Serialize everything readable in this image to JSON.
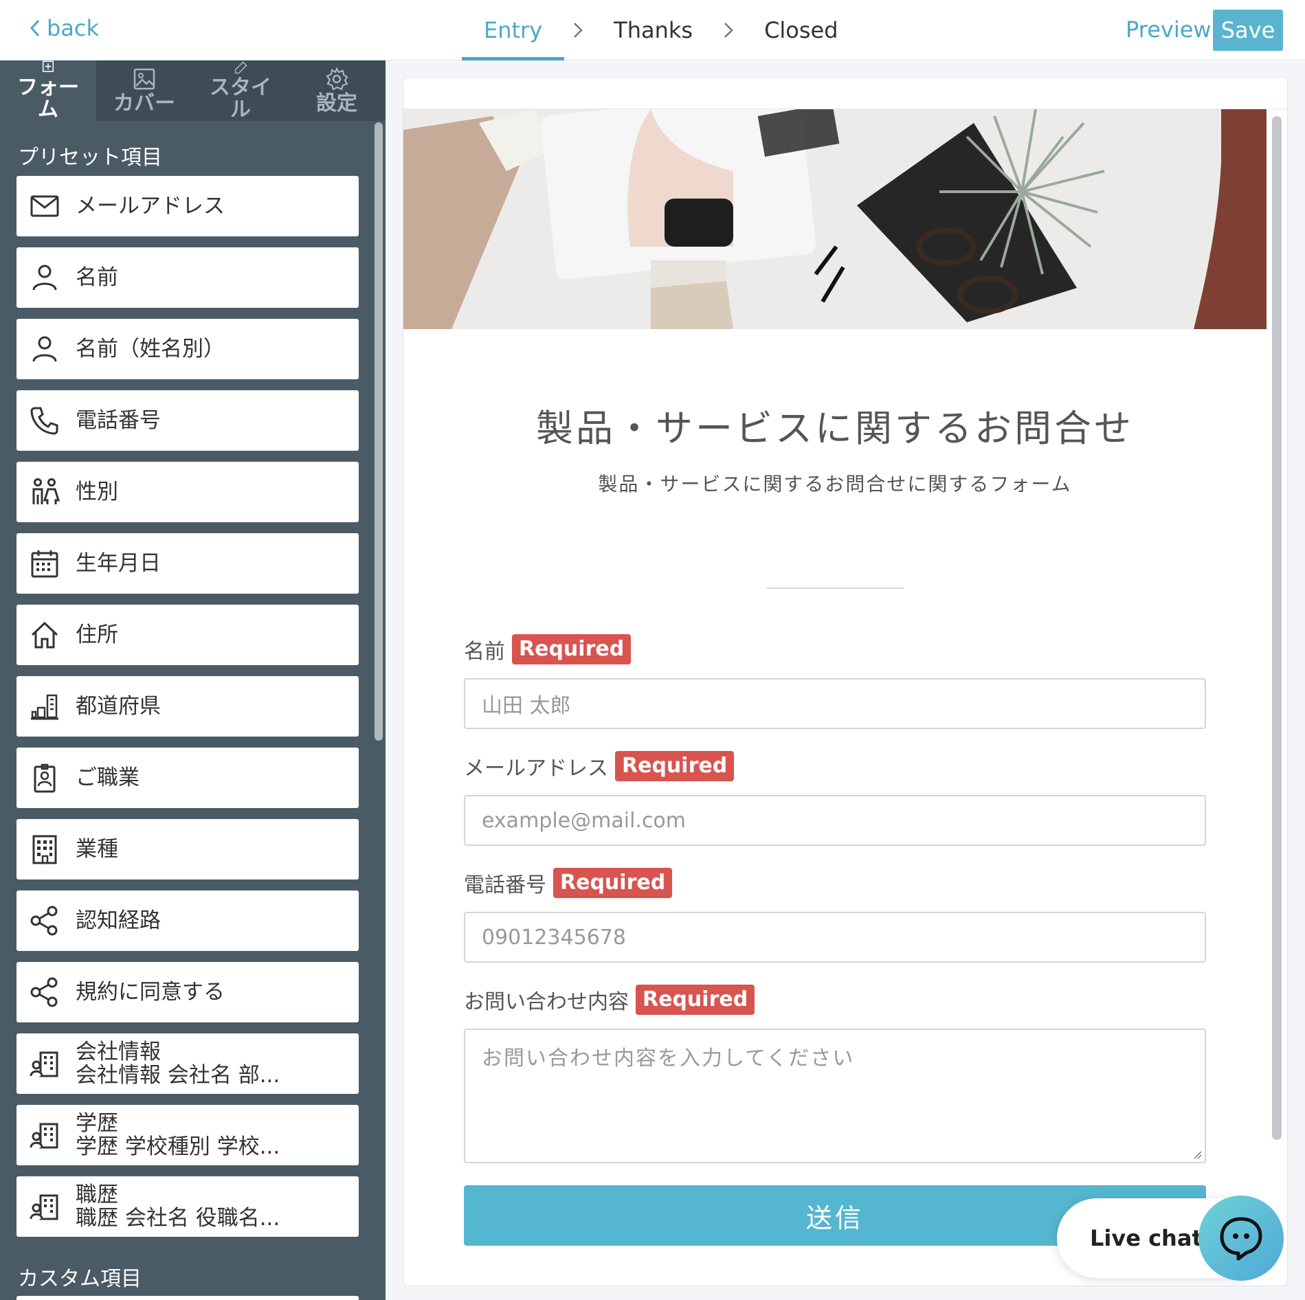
{
  "topbar": {
    "back_label": "back",
    "steps": [
      {
        "label": "Entry",
        "active": true
      },
      {
        "label": "Thanks",
        "active": false
      },
      {
        "label": "Closed",
        "active": false
      }
    ],
    "preview_label": "Preview",
    "save_label": "Save"
  },
  "sidebar": {
    "tabs": [
      {
        "label": "フォーム",
        "icon": "plus-square-icon",
        "active": true
      },
      {
        "label": "カバー",
        "icon": "image-icon",
        "active": false
      },
      {
        "label": "スタイル",
        "icon": "pen-icon",
        "active": false
      },
      {
        "label": "設定",
        "icon": "gear-icon",
        "active": false
      }
    ],
    "preset_heading": "プリセット項目",
    "custom_heading": "カスタム項目",
    "presets": [
      {
        "label": "メールアドレス",
        "icon": "mail-icon"
      },
      {
        "label": "名前",
        "icon": "person-icon"
      },
      {
        "label": "名前（姓名別）",
        "icon": "person-icon"
      },
      {
        "label": "電話番号",
        "icon": "phone-icon"
      },
      {
        "label": "性別",
        "icon": "gender-icon"
      },
      {
        "label": "生年月日",
        "icon": "calendar-icon"
      },
      {
        "label": "住所",
        "icon": "home-icon"
      },
      {
        "label": "都道府県",
        "icon": "buildings-icon"
      },
      {
        "label": "ご職業",
        "icon": "badge-icon"
      },
      {
        "label": "業種",
        "icon": "office-icon"
      },
      {
        "label": "認知経路",
        "icon": "share-icon"
      },
      {
        "label": "規約に同意する",
        "icon": "share-icon"
      },
      {
        "label": "会社情報",
        "sub": "会社情報 会社名 部...",
        "icon": "company-person-icon"
      },
      {
        "label": "学歴",
        "sub": "学歴 学校種別 学校...",
        "icon": "company-person-icon"
      },
      {
        "label": "職歴",
        "sub": "職歴 会社名 役職名...",
        "icon": "company-person-icon"
      }
    ]
  },
  "form": {
    "title": "製品・サービスに関するお問合せ",
    "subtitle": "製品・サービスに関するお問合せに関するフォーム",
    "required_label": "Required",
    "fields": [
      {
        "label": "名前",
        "placeholder": "山田 太郎"
      },
      {
        "label": "メールアドレス",
        "placeholder": "example@mail.com"
      },
      {
        "label": "電話番号",
        "placeholder": "09012345678"
      },
      {
        "label": "お問い合わせ内容",
        "placeholder": "お問い合わせ内容を入力してください"
      }
    ],
    "submit_label": "送信"
  },
  "livechat": {
    "label": "Live chat"
  },
  "colors": {
    "accent": "#4aa8c9",
    "sidebar_bg": "#4b5b66",
    "required_badge": "#d9534f",
    "submit_bg": "#55b6cf"
  }
}
